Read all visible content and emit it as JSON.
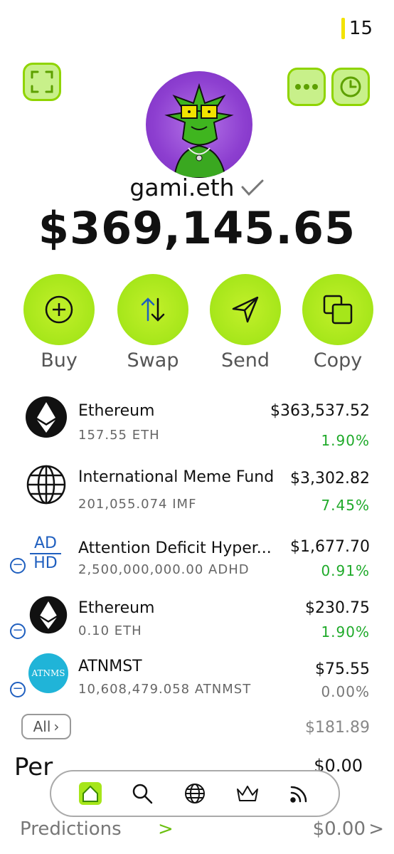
{
  "status": {
    "count": "15"
  },
  "profile": {
    "username": "gami.eth",
    "balance": "$369,145.65"
  },
  "actions": [
    {
      "label": "Buy"
    },
    {
      "label": "Swap"
    },
    {
      "label": "Send"
    },
    {
      "label": "Copy"
    }
  ],
  "tokens": [
    {
      "name": "Ethereum",
      "amount": "157.55 ETH",
      "usd": "$363,537.52",
      "change": "1.90%",
      "icon": "ethereum-icon"
    },
    {
      "name": "International Meme Fund",
      "amount": "201,055.074 IMF",
      "usd": "$3,302.82",
      "change": "7.45%",
      "icon": "globe-icon"
    },
    {
      "name": "Attention Deficit Hyper...",
      "amount": "2,500,000,000.00 ADHD",
      "usd": "$1,677.70",
      "change": "0.91%",
      "icon": "adhd-icon",
      "icon_text_top": "AD",
      "icon_text_bottom": "HD"
    },
    {
      "name": "Ethereum",
      "amount": "0.10 ETH",
      "usd": "$230.75",
      "change": "1.90%",
      "icon": "ethereum-icon"
    },
    {
      "name": "ATNMST",
      "amount": "10,608,479.058 ATNMST",
      "usd": "$75.55",
      "change": "0.00%",
      "icon": "atnms-icon",
      "icon_text": "ATNMS"
    }
  ],
  "all": {
    "label": "All",
    "total": "$181.89"
  },
  "perps": {
    "label": "Per",
    "value": "$0.00"
  },
  "nav": [
    "home-icon",
    "search-icon",
    "globe-icon",
    "crown-icon",
    "feed-icon"
  ],
  "predictions": {
    "label": "Predictions",
    "chevron": ">",
    "value": "$0.00",
    "chevron2": ">"
  },
  "colors": {
    "accent": "#a6e61a",
    "positive": "#1faa2a",
    "avatar_bg": "#8d3fd0"
  }
}
